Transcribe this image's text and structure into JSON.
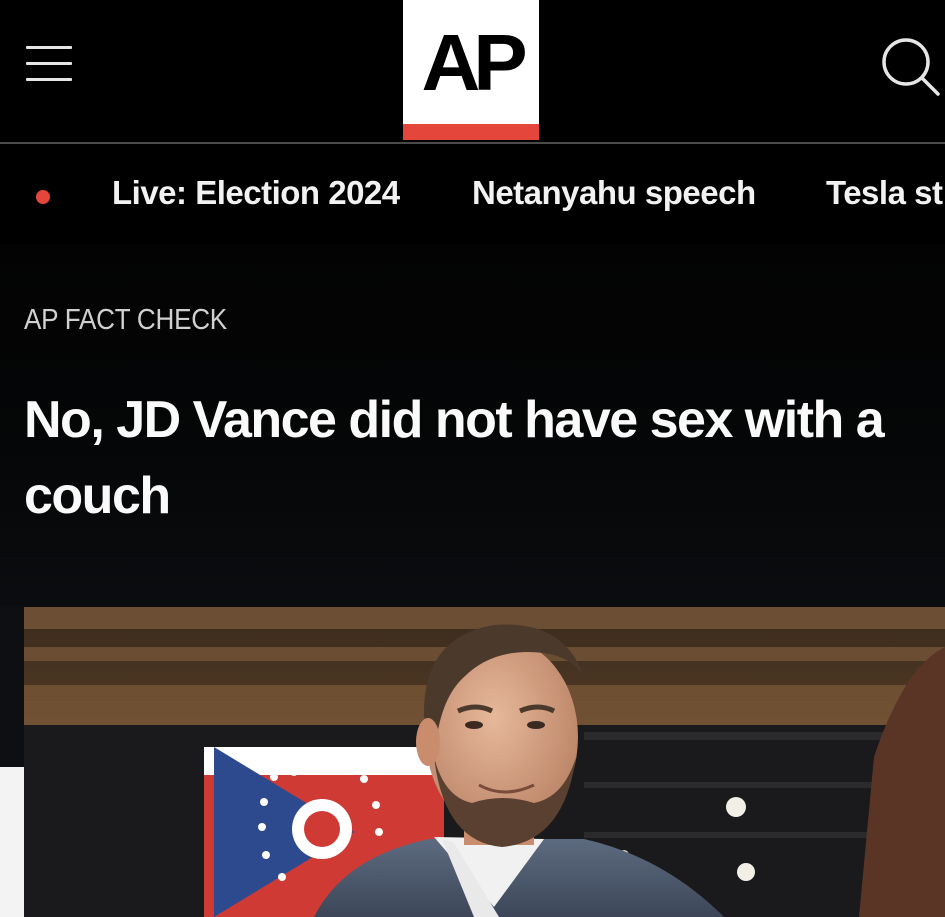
{
  "header": {
    "menu_icon": "hamburger-menu-icon",
    "logo_text": "AP",
    "search_icon": "search-icon",
    "colors": {
      "background": "#000000",
      "brand_red": "#e5463c"
    }
  },
  "trending": {
    "live_indicator_color": "#e5463c",
    "items": [
      {
        "label": "Live: Election 2024"
      },
      {
        "label": "Netanyahu speech"
      },
      {
        "label": "Tesla st"
      }
    ]
  },
  "article": {
    "eyebrow": "AP FACT CHECK",
    "headline": "No, JD Vance did not have sex with a couch",
    "image_description_icon": "photo-of-man-smiling-in-front-of-ohio-flag"
  }
}
